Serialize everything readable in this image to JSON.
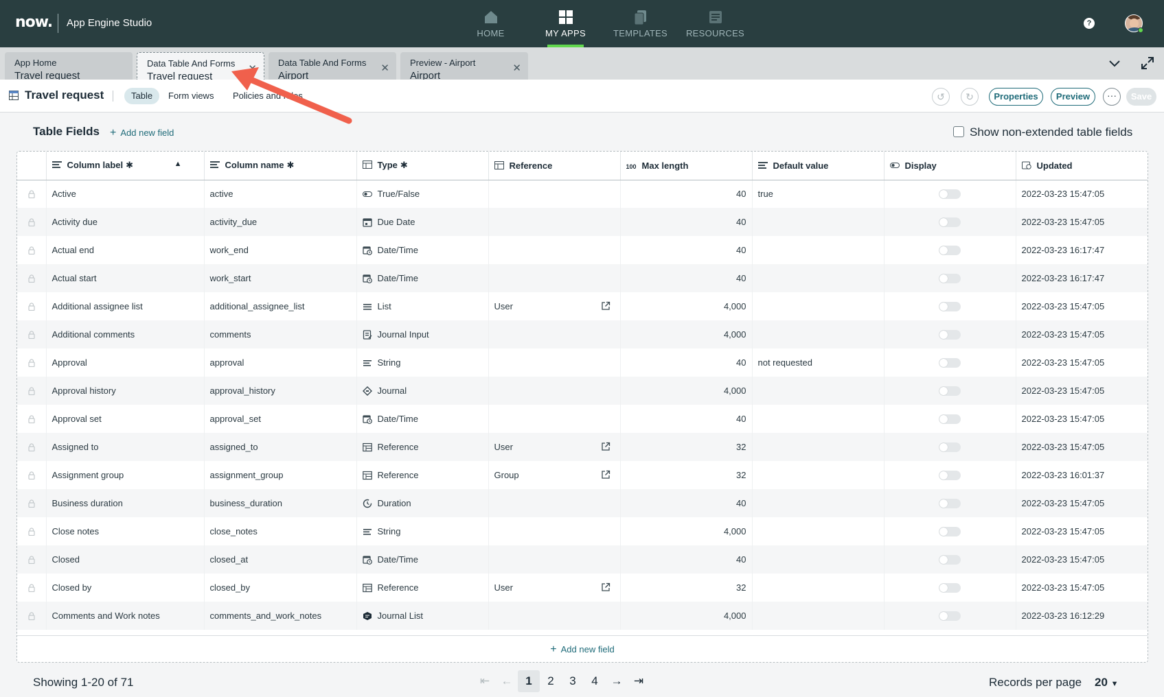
{
  "app": {
    "logo": "now.",
    "studio_name": "App Engine Studio"
  },
  "nav": {
    "items": [
      {
        "label": "HOME",
        "icon": "home-icon"
      },
      {
        "label": "MY APPS",
        "icon": "grid-icon",
        "active": true
      },
      {
        "label": "TEMPLATES",
        "icon": "templates-icon"
      },
      {
        "label": "RESOURCES",
        "icon": "resources-icon"
      }
    ],
    "help": "?"
  },
  "tabs": [
    {
      "title": "App Home",
      "sub": "Travel request",
      "closable": false
    },
    {
      "title": "Data Table And Forms",
      "sub": "Travel request",
      "closable": true,
      "active": true
    },
    {
      "title": "Data Table And Forms",
      "sub": "Airport",
      "closable": true
    },
    {
      "title": "Preview - Airport",
      "sub": "Airport",
      "closable": true
    }
  ],
  "page": {
    "title": "Travel request",
    "subtabs": [
      "Table",
      "Form views",
      "Policies and rules"
    ],
    "buttons": {
      "properties": "Properties",
      "preview": "Preview",
      "more": "···",
      "save": "Save"
    }
  },
  "section": {
    "title": "Table Fields",
    "add_new_field": "Add new field",
    "show_nonextended": "Show non-extended table fields"
  },
  "columns": {
    "label": "Column label",
    "name": "Column name",
    "type": "Type",
    "reference": "Reference",
    "maxlength": "Max length",
    "default": "Default value",
    "display": "Display",
    "updated": "Updated",
    "required_mark": "✱",
    "maxlength_icon_text": "100"
  },
  "rows": [
    {
      "label": "Active",
      "name": "active",
      "type": "True/False",
      "type_icon": "toggle-icon",
      "ref": "",
      "max": "40",
      "def": "true",
      "updated": "2022-03-23 15:47:05"
    },
    {
      "label": "Activity due",
      "name": "activity_due",
      "type": "Due Date",
      "type_icon": "calendar-icon",
      "ref": "",
      "max": "40",
      "def": "",
      "updated": "2022-03-23 15:47:05"
    },
    {
      "label": "Actual end",
      "name": "work_end",
      "type": "Date/Time",
      "type_icon": "datetime-icon",
      "ref": "",
      "max": "40",
      "def": "",
      "updated": "2022-03-23 16:17:47"
    },
    {
      "label": "Actual start",
      "name": "work_start",
      "type": "Date/Time",
      "type_icon": "datetime-icon",
      "ref": "",
      "max": "40",
      "def": "",
      "updated": "2022-03-23 16:17:47"
    },
    {
      "label": "Additional assignee list",
      "name": "additional_assignee_list",
      "type": "List",
      "type_icon": "list-icon",
      "ref": "User",
      "max": "4,000",
      "def": "",
      "updated": "2022-03-23 15:47:05"
    },
    {
      "label": "Additional comments",
      "name": "comments",
      "type": "Journal Input",
      "type_icon": "journal-input-icon",
      "ref": "",
      "max": "4,000",
      "def": "",
      "updated": "2022-03-23 15:47:05"
    },
    {
      "label": "Approval",
      "name": "approval",
      "type": "String",
      "type_icon": "string-icon",
      "ref": "",
      "max": "40",
      "def": "not requested",
      "updated": "2022-03-23 15:47:05"
    },
    {
      "label": "Approval history",
      "name": "approval_history",
      "type": "Journal",
      "type_icon": "journal-icon",
      "ref": "",
      "max": "4,000",
      "def": "",
      "updated": "2022-03-23 15:47:05"
    },
    {
      "label": "Approval set",
      "name": "approval_set",
      "type": "Date/Time",
      "type_icon": "datetime-icon",
      "ref": "",
      "max": "40",
      "def": "",
      "updated": "2022-03-23 15:47:05"
    },
    {
      "label": "Assigned to",
      "name": "assigned_to",
      "type": "Reference",
      "type_icon": "reference-icon",
      "ref": "User",
      "max": "32",
      "def": "",
      "updated": "2022-03-23 15:47:05"
    },
    {
      "label": "Assignment group",
      "name": "assignment_group",
      "type": "Reference",
      "type_icon": "reference-icon",
      "ref": "Group",
      "max": "32",
      "def": "",
      "updated": "2022-03-23 16:01:37"
    },
    {
      "label": "Business duration",
      "name": "business_duration",
      "type": "Duration",
      "type_icon": "duration-icon",
      "ref": "",
      "max": "40",
      "def": "",
      "updated": "2022-03-23 15:47:05"
    },
    {
      "label": "Close notes",
      "name": "close_notes",
      "type": "String",
      "type_icon": "string-icon",
      "ref": "",
      "max": "4,000",
      "def": "",
      "updated": "2022-03-23 15:47:05"
    },
    {
      "label": "Closed",
      "name": "closed_at",
      "type": "Date/Time",
      "type_icon": "datetime-icon",
      "ref": "",
      "max": "40",
      "def": "",
      "updated": "2022-03-23 15:47:05"
    },
    {
      "label": "Closed by",
      "name": "closed_by",
      "type": "Reference",
      "type_icon": "reference-icon",
      "ref": "User",
      "max": "32",
      "def": "",
      "updated": "2022-03-23 15:47:05"
    },
    {
      "label": "Comments and Work notes",
      "name": "comments_and_work_notes",
      "type": "Journal List",
      "type_icon": "journal-list-icon",
      "ref": "",
      "max": "4,000",
      "def": "",
      "updated": "2022-03-23 16:12:29"
    }
  ],
  "footer": {
    "showing": "Showing 1-20 of 71",
    "pages": [
      "1",
      "2",
      "3",
      "4"
    ],
    "current_page": "1",
    "rpp_label": "Records per page",
    "rpp_value": "20"
  },
  "colors": {
    "topbar": "#293e40",
    "accent_green": "#62d84e",
    "link_teal": "#1f6b79",
    "annotation_arrow": "#f0604c"
  }
}
